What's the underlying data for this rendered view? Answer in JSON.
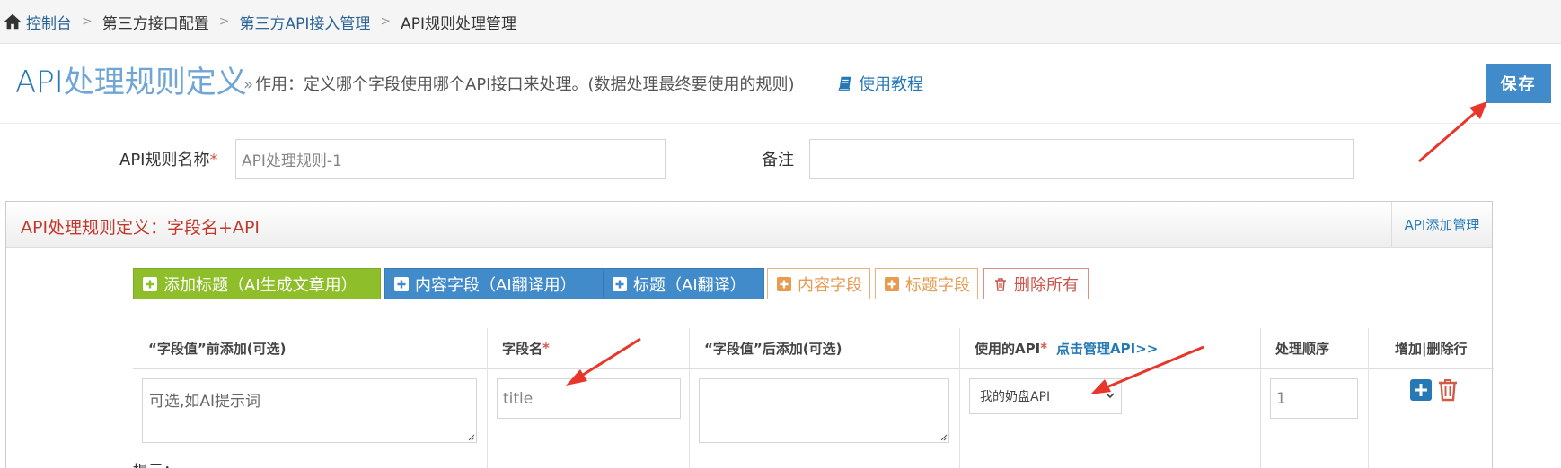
{
  "breadcrumb": {
    "items": [
      {
        "label": "控制台",
        "link": true
      },
      {
        "label": "第三方接口配置",
        "link": false
      },
      {
        "label": "第三方API接入管理",
        "link": true
      },
      {
        "label": "API规则处理管理",
        "link": false
      }
    ]
  },
  "header": {
    "title_main": "API",
    "title_rest": "处理规则定义",
    "description_prefix": "»",
    "description": "作用：定义哪个字段使用哪个API接口来处理。(数据处理最终要使用的规则)",
    "tutorial_label": "使用教程",
    "save_label": "保存"
  },
  "form": {
    "rule_name_label": "API规则名称",
    "rule_name_required": "*",
    "rule_name_value": "API处理规则-1",
    "remark_label": "备注",
    "remark_value": ""
  },
  "widget": {
    "title": "API处理规则定义：字段名+API",
    "toolbar_link": "API添加管理"
  },
  "actions": {
    "add_title": "添加标题（AI生成文章用）",
    "content_field_ai": "内容字段（AI翻译用）",
    "title_ai": "标题（AI翻译）",
    "content_field": "内容字段",
    "title_field": "标题字段",
    "delete_all": "删除所有"
  },
  "table": {
    "headers": {
      "prefix": "“字段值”前添加(可选)",
      "field_name": "字段名",
      "field_name_required": "*",
      "suffix": "“字段值”后添加(可选)",
      "api": "使用的API",
      "api_required": "*",
      "api_manage_link": "点击管理API>>",
      "order": "处理顺序",
      "add_delete": "增加|删除行"
    },
    "rows": [
      {
        "prefix_placeholder": "可选,如AI提示词",
        "field_name_placeholder": "title",
        "suffix_value": "",
        "api_selected": "我的奶盘API",
        "order_placeholder": "1"
      }
    ]
  },
  "hint_label": "提示：",
  "colors": {
    "accent_blue": "#428bca",
    "title_blue": "#2679b5",
    "green": "#8ebf2a",
    "orange": "#e69b4f",
    "red": "#c9564b",
    "arrow_red": "#e8372a"
  },
  "icons": [
    "home-icon",
    "book-icon",
    "plus-square-icon",
    "trash-icon",
    "chevron-down-icon",
    "resize-grip-icon"
  ]
}
